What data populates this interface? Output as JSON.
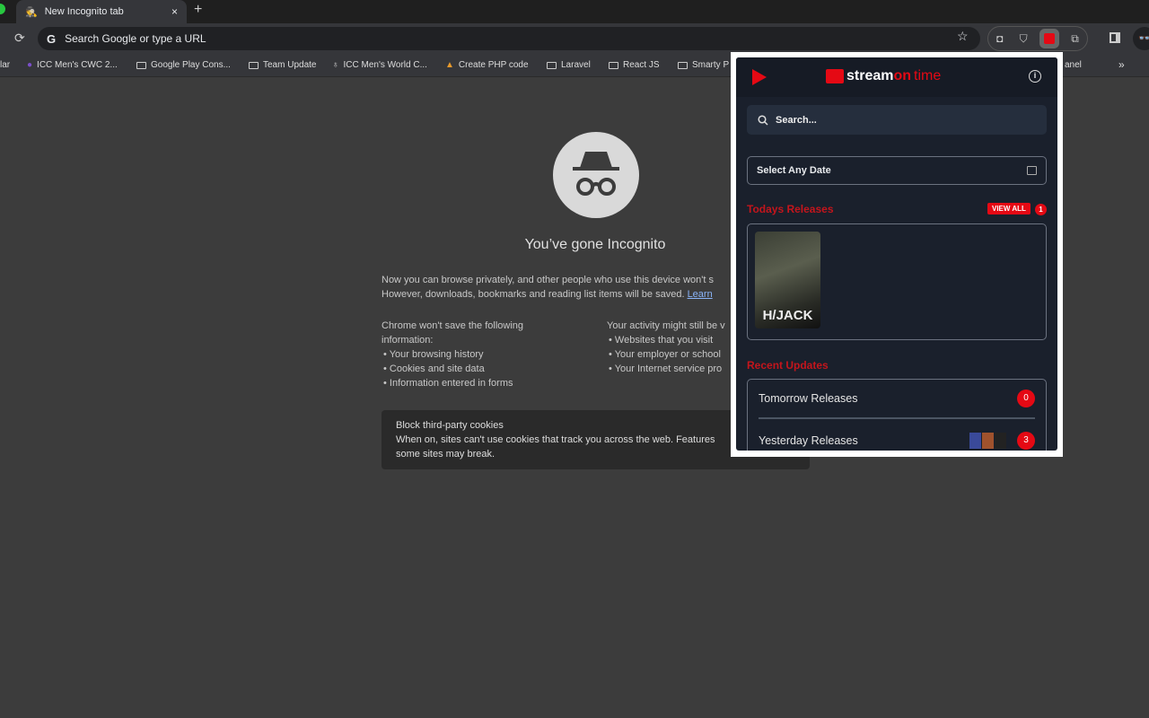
{
  "tab": {
    "title": "New Incognito tab",
    "close": "×",
    "new": "+"
  },
  "toolbar": {
    "omnibox_placeholder": "Search Google or type a URL",
    "google_letter": "G",
    "incognito": "👓"
  },
  "bookmarks": [
    {
      "label": "lar",
      "icon": "none"
    },
    {
      "label": "ICC Men's CWC 2...",
      "icon": "site"
    },
    {
      "label": "Google Play Cons...",
      "icon": "folder"
    },
    {
      "label": "Team Update",
      "icon": "folder"
    },
    {
      "label": "ICC Men's World C...",
      "icon": "site"
    },
    {
      "label": "Create PHP code",
      "icon": "site"
    },
    {
      "label": "Laravel",
      "icon": "folder"
    },
    {
      "label": "React JS",
      "icon": "folder"
    },
    {
      "label": "Smarty P",
      "icon": "folder"
    },
    {
      "label": "anel",
      "icon": "none"
    }
  ],
  "bookmarks_more": "»",
  "incognito": {
    "title": "You’ve gone Incognito",
    "intro1": "Now you can browse privately, and other people who use this device won't s",
    "intro2": "However, downloads, bookmarks and reading list items will be saved.",
    "learn": "Learn",
    "left_heading1": "Chrome won't save the following",
    "left_heading2": "information:",
    "left_items": [
      "Your browsing history",
      "Cookies and site data",
      "Information entered in forms"
    ],
    "right_heading": "Your activity might still be v",
    "right_items": [
      "Websites that you visit",
      "Your employer or school",
      "Your Internet service pro"
    ],
    "cookie_title": "Block third-party cookies",
    "cookie_text1": "When on, sites can't use cookies that track you across the web. Features",
    "cookie_text2": "some sites may break."
  },
  "popup": {
    "logo_a": "stream",
    "logo_b": "on",
    "logo_c": "time",
    "info": "i",
    "search_placeholder": "Search...",
    "date_label": "Select Any Date",
    "todays_heading": "Todays Releases",
    "view_all": "VIEW ALL",
    "todays_count": "1",
    "poster_title": "H/JACK",
    "recent_heading": "Recent Updates",
    "recent": [
      {
        "label": "Tomorrow Releases",
        "count": "0"
      },
      {
        "label": "Yesterday Releases",
        "count": "3"
      }
    ],
    "colors": {
      "accent": "#e50914",
      "bg": "#1a202c"
    }
  }
}
